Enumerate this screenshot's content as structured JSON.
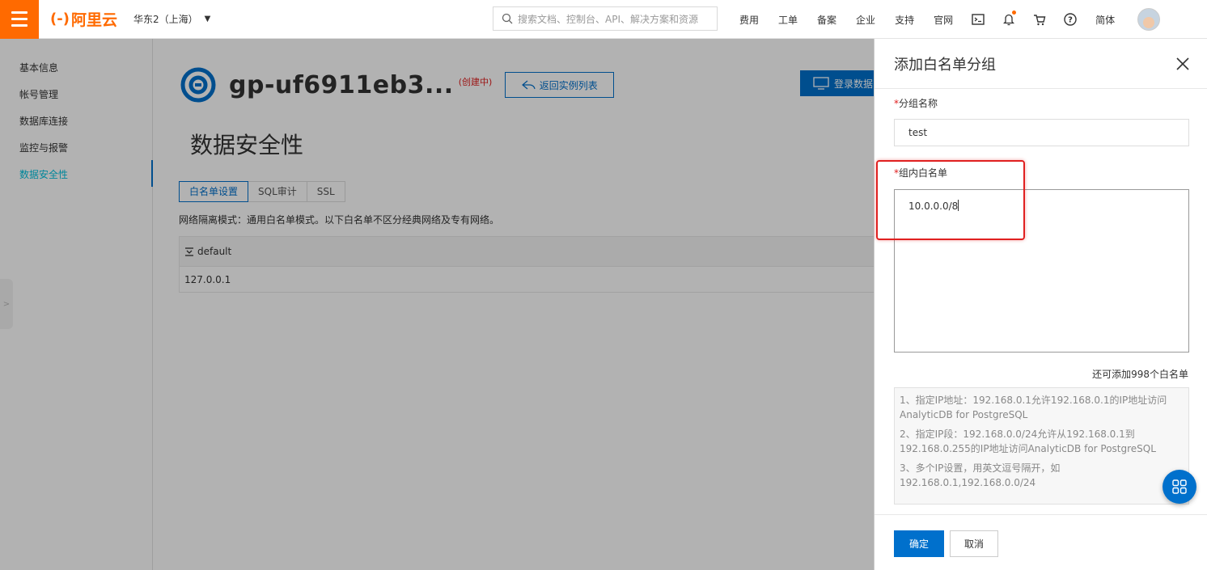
{
  "topbar": {
    "logo_mark": "(-)",
    "logo_text": "阿里云",
    "region": "华东2（上海）",
    "search_placeholder": "搜索文档、控制台、API、解决方案和资源",
    "nav": [
      "费用",
      "工单",
      "备案",
      "企业",
      "支持",
      "官网"
    ],
    "language": "简体",
    "brand_color": "#ff6a00"
  },
  "sidebar": {
    "items": [
      "基本信息",
      "帐号管理",
      "数据库连接",
      "监控与报警",
      "数据安全性"
    ],
    "active_index": 4,
    "collapse_glyph": ">"
  },
  "instance": {
    "title": "gp-uf6911eb3...",
    "status": "(创建中)",
    "back_label": "返回实例列表",
    "login_label": "登录数据"
  },
  "section": {
    "title": "数据安全性",
    "tabs": [
      "白名单设置",
      "SQL审计",
      "SSL"
    ],
    "network_mode": "网络隔离模式：通用白名单模式。以下白名单不区分经典网络及专有网络。",
    "group_name": "default",
    "group_ip": "127.0.0.1"
  },
  "drawer": {
    "title": "添加白名单分组",
    "req_mark": "*",
    "group_name_label": "分组名称",
    "group_name_value": "test",
    "whitelist_label": "组内白名单",
    "whitelist_value": "10.0.0.0/8",
    "remaining": "还可添加998个白名单",
    "tips": [
      "1、指定IP地址：192.168.0.1允许192.168.0.1的IP地址访问AnalyticDB for PostgreSQL",
      "2、指定IP段：192.168.0.0/24允许从192.168.0.1到192.168.0.255的IP地址访问AnalyticDB for PostgreSQL",
      "3、多个IP设置，用英文逗号隔开，如192.168.0.1,192.168.0.0/24"
    ],
    "ok_label": "确定",
    "cancel_label": "取消",
    "accent_color": "#0070cc",
    "highlight_color": "#e02020"
  }
}
